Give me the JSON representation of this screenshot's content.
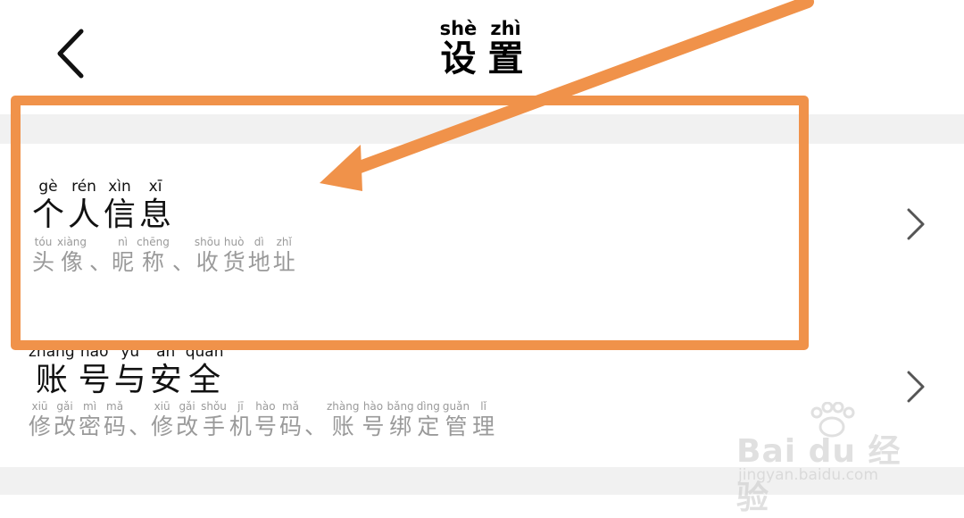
{
  "header": {
    "back_icon": "chevron-left-icon",
    "title": [
      {
        "pinyin": "shè",
        "hanzi": "设"
      },
      {
        "pinyin": "zhì",
        "hanzi": "置"
      }
    ]
  },
  "rows": [
    {
      "title": [
        {
          "pinyin": "gè",
          "hanzi": "个"
        },
        {
          "pinyin": "rén",
          "hanzi": "人"
        },
        {
          "pinyin": "xìn",
          "hanzi": "信"
        },
        {
          "pinyin": "xī",
          "hanzi": "息"
        }
      ],
      "subtitle": [
        {
          "pinyin": "tóu",
          "hanzi": "头"
        },
        {
          "pinyin": "xiàng",
          "hanzi": "像"
        },
        {
          "sep": "、"
        },
        {
          "pinyin": "nì",
          "hanzi": "昵"
        },
        {
          "pinyin": "chēng",
          "hanzi": "称"
        },
        {
          "sep": "、"
        },
        {
          "pinyin": "shōu",
          "hanzi": "收"
        },
        {
          "pinyin": "huò",
          "hanzi": "货"
        },
        {
          "pinyin": "dì",
          "hanzi": "地"
        },
        {
          "pinyin": "zhǐ",
          "hanzi": "址"
        }
      ],
      "chevron_icon": "chevron-right-icon"
    },
    {
      "title": [
        {
          "pinyin": "zhàng",
          "hanzi": "账"
        },
        {
          "pinyin": "hào",
          "hanzi": "号"
        },
        {
          "pinyin": "yǔ",
          "hanzi": "与"
        },
        {
          "pinyin": "ān",
          "hanzi": "安"
        },
        {
          "pinyin": "quán",
          "hanzi": "全"
        }
      ],
      "subtitle": [
        {
          "pinyin": "xiū",
          "hanzi": "修"
        },
        {
          "pinyin": "gǎi",
          "hanzi": "改"
        },
        {
          "pinyin": "mì",
          "hanzi": "密"
        },
        {
          "pinyin": "mǎ",
          "hanzi": "码"
        },
        {
          "sep": "、"
        },
        {
          "pinyin": "xiū",
          "hanzi": "修"
        },
        {
          "pinyin": "gǎi",
          "hanzi": "改"
        },
        {
          "pinyin": "shǒu",
          "hanzi": "手"
        },
        {
          "pinyin": "jī",
          "hanzi": "机"
        },
        {
          "pinyin": "hào",
          "hanzi": "号"
        },
        {
          "pinyin": "mǎ",
          "hanzi": "码"
        },
        {
          "sep": "、"
        },
        {
          "pinyin": "zhàng",
          "hanzi": "账"
        },
        {
          "pinyin": "hào",
          "hanzi": "号"
        },
        {
          "pinyin": "bǎng",
          "hanzi": "绑"
        },
        {
          "pinyin": "dìng",
          "hanzi": "定"
        },
        {
          "pinyin": "guǎn",
          "hanzi": "管"
        },
        {
          "pinyin": "lǐ",
          "hanzi": "理"
        }
      ],
      "chevron_icon": "chevron-right-icon"
    }
  ],
  "annotation": {
    "color": "#f0924a",
    "box_icon": "highlight-box",
    "arrow_icon": "arrow-icon"
  },
  "watermark": {
    "brand": "Bai du 经验",
    "url": "jingyan.baidu.com",
    "icon": "paw-icon"
  }
}
